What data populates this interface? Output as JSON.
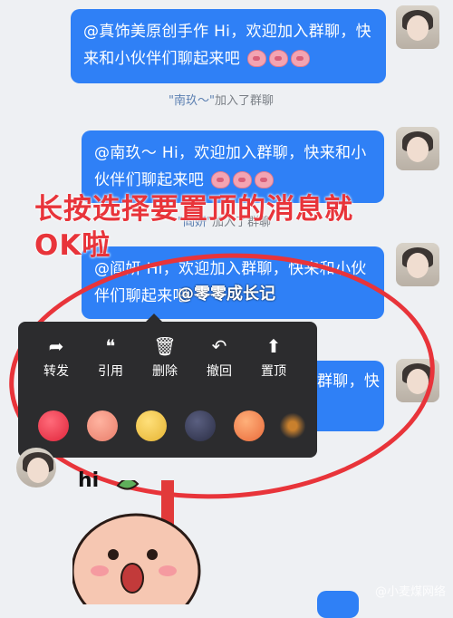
{
  "messages": [
    {
      "text": "@真饰美原创手作 Hi，欢迎加入群聊，快来和小伙伴们聊起来吧"
    },
    {
      "text": "@南玖～ Hi，欢迎加入群聊，快来和小伙伴们聊起来吧"
    },
    {
      "text": "@阎妍 Hi，欢迎加入群聊，快来和小伙伴们聊起来吧"
    },
    {
      "text": "群聊，快"
    }
  ],
  "system_notes": [
    {
      "name": "\"南玖～\"",
      "suffix": "加入了群聊"
    },
    {
      "name": "\"阎妍\"",
      "suffix": "加入了群聊"
    }
  ],
  "overlay_mention": "@零零成长记",
  "annotation": {
    "line1": "长按选择要置顶的消息就",
    "line2": "OK啦"
  },
  "menu": {
    "actions": [
      {
        "label": "转发",
        "icon": "forward-icon",
        "glyph": "➦"
      },
      {
        "label": "引用",
        "icon": "quote-icon",
        "glyph": "❝"
      },
      {
        "label": "删除",
        "icon": "trash-icon",
        "glyph": "🗑"
      },
      {
        "label": "撤回",
        "icon": "undo-icon",
        "glyph": "↶"
      },
      {
        "label": "置顶",
        "icon": "pin-top-icon",
        "glyph": "⬆"
      }
    ],
    "reactions": [
      "heart",
      "thumbs-up",
      "mascot",
      "dark-face",
      "party-horn",
      "firework"
    ]
  },
  "sticker": {
    "text": "hi"
  },
  "watermark": "@小麦煤网络",
  "colors": {
    "bubble": "#2f80f6",
    "annotation": "#e8343a",
    "menu": "#2c2c2e"
  }
}
